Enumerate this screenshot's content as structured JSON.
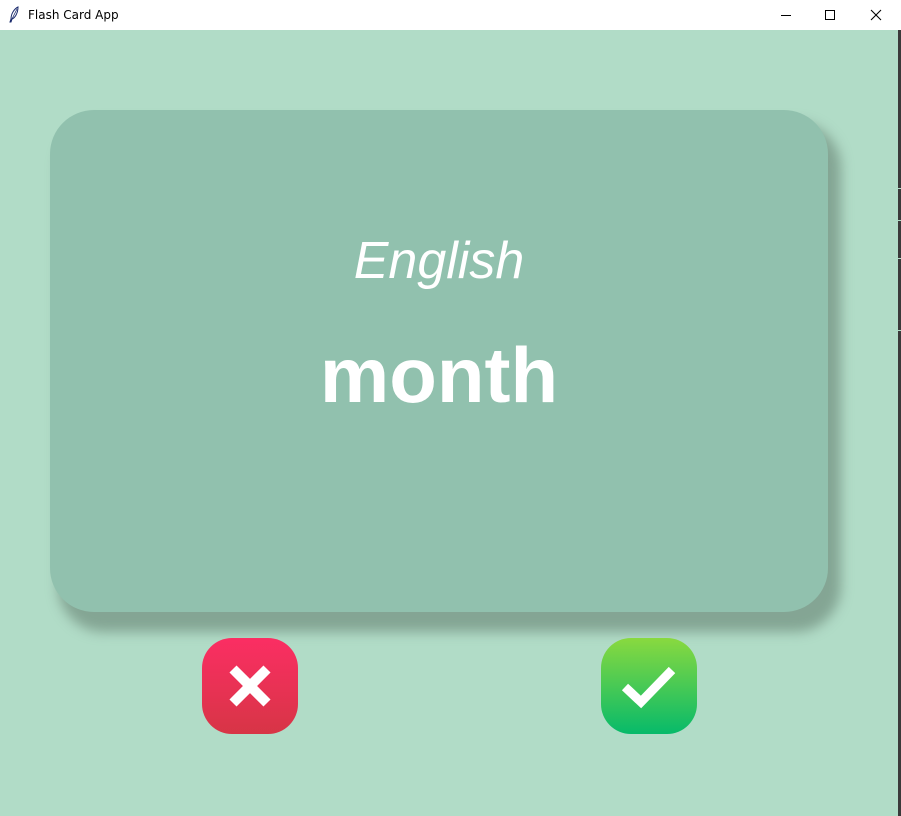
{
  "window": {
    "title": "Flash Card App",
    "controls": [
      "minimize",
      "maximize",
      "close"
    ]
  },
  "card": {
    "title": "English",
    "word": "month",
    "color": "#91c1ae"
  },
  "buttons": {
    "wrong": {
      "icon": "x-icon",
      "color": "#e93155"
    },
    "right": {
      "icon": "check-icon",
      "color": "#2cc45c"
    }
  },
  "colors": {
    "background": "#b1dcc7",
    "text": "#ffffff"
  }
}
